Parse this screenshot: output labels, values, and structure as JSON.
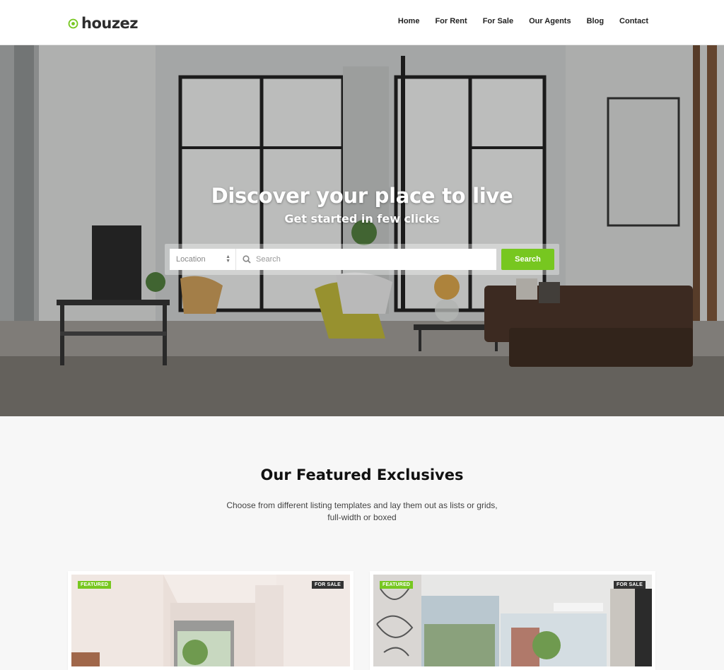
{
  "header": {
    "logo_text": "houzez",
    "nav": [
      {
        "label": "Home"
      },
      {
        "label": "For Rent"
      },
      {
        "label": "For Sale"
      },
      {
        "label": "Our Agents"
      },
      {
        "label": "Blog"
      },
      {
        "label": "Contact"
      }
    ]
  },
  "hero": {
    "title": "Discover your place to live",
    "subtitle": "Get started in few clicks",
    "search": {
      "location_value": "Location",
      "search_placeholder": "Search",
      "button_label": "Search"
    }
  },
  "featured": {
    "title": "Our Featured Exclusives",
    "description_line1": "Choose from different listing templates and lay them out as lists or grids,",
    "description_line2": "full-width or boxed",
    "cards": [
      {
        "badge_left": "FEATURED",
        "badge_right": "FOR SALE"
      },
      {
        "badge_left": "FEATURED",
        "badge_right": "FOR SALE"
      }
    ]
  },
  "colors": {
    "accent": "#77c720",
    "dark_badge": "#333333"
  }
}
